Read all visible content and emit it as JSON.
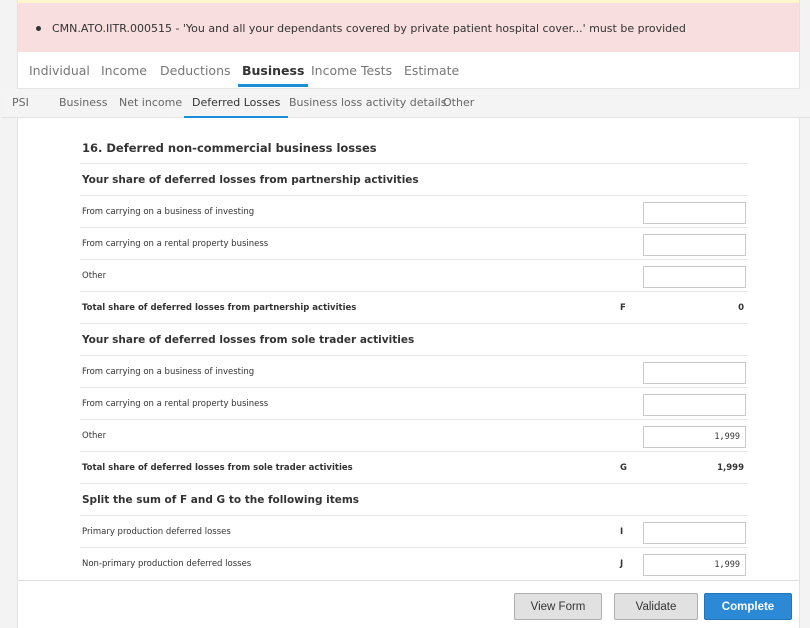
{
  "alert": {
    "message": "CMN.ATO.IITR.000515 - 'You and all your dependants covered by private patient hospital cover...' must be provided"
  },
  "main_tabs": [
    {
      "label": "Individual"
    },
    {
      "label": "Income"
    },
    {
      "label": "Deductions"
    },
    {
      "label": "Business",
      "active": true
    },
    {
      "label": "Income Tests"
    },
    {
      "label": "Estimate"
    }
  ],
  "sub_tabs": [
    {
      "label": "PSI"
    },
    {
      "label": "Business"
    },
    {
      "label": "Net income"
    },
    {
      "label": "Deferred Losses",
      "active": true
    },
    {
      "label": "Business loss activity details"
    },
    {
      "label": "Other"
    }
  ],
  "form": {
    "title": "16. Deferred non-commercial business losses",
    "rows": [
      {
        "type": "heading",
        "label": "Your share of deferred losses from partnership activities"
      },
      {
        "type": "input",
        "label": "From carrying on a business of investing",
        "value": ""
      },
      {
        "type": "input",
        "label": "From carrying on a rental property business",
        "value": ""
      },
      {
        "type": "input",
        "label": "Other",
        "value": ""
      },
      {
        "type": "total",
        "label": "Total share of deferred losses from partnership activities",
        "code": "F",
        "value": "0"
      },
      {
        "type": "heading",
        "label": "Your share of deferred losses from sole trader activities"
      },
      {
        "type": "input",
        "label": "From carrying on a business of investing",
        "value": ""
      },
      {
        "type": "input",
        "label": "From carrying on a rental property business",
        "value": ""
      },
      {
        "type": "input",
        "label": "Other",
        "value": "1,999"
      },
      {
        "type": "total",
        "label": "Total share of deferred losses from sole trader activities",
        "code": "G",
        "value": "1,999"
      },
      {
        "type": "heading",
        "label": "Split the sum of F and G to the following items"
      },
      {
        "type": "input",
        "label": "Primary production deferred losses",
        "code": "I",
        "value": ""
      },
      {
        "type": "input",
        "label": "Non-primary production deferred losses",
        "code": "J",
        "value": "1,999"
      }
    ]
  },
  "footer": {
    "view_form": "View Form",
    "validate": "Validate",
    "complete": "Complete"
  },
  "colors": {
    "accent": "#1a8fd8",
    "alert_bg": "#f8dede",
    "complete_button": "#2c89d5"
  }
}
